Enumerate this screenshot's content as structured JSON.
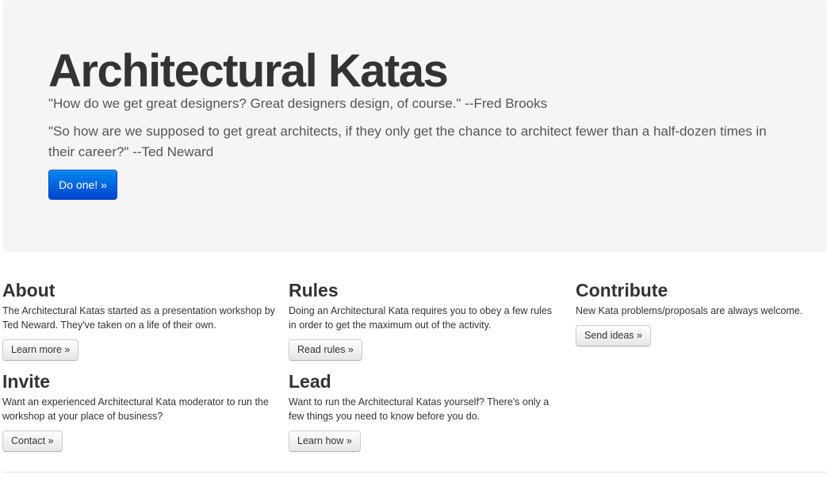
{
  "hero": {
    "title": "Architectural Katas",
    "quote1": "\"How do we get great designers? Great designers design, of course.\" --Fred Brooks",
    "quote2": "\"So how are we supposed to get great architects, if they only get the chance to architect fewer than a half-dozen times in their career?\" --Ted Neward",
    "cta_label": "Do one! »"
  },
  "sections": {
    "about": {
      "title": "About",
      "text": "The Architectural Katas started as a presentation workshop by Ted Neward. They've taken on a life of their own.",
      "button": "Learn more »"
    },
    "rules": {
      "title": "Rules",
      "text": "Doing an Architectural Kata requires you to obey a few rules in order to get the maximum out of the activity.",
      "button": "Read rules »"
    },
    "contribute": {
      "title": "Contribute",
      "text": "New Kata problems/proposals are always welcome.",
      "button": "Send ideas »"
    },
    "invite": {
      "title": "Invite",
      "text": "Want an experienced Architectural Kata moderator to run the workshop at your place of business?",
      "button": "Contact »"
    },
    "lead": {
      "title": "Lead",
      "text": "Want to run the Architectural Katas yourself? There's only a few things you need to know before you do.",
      "button": "Learn how »"
    }
  },
  "colors": {
    "hero_background": "#f5f5f5",
    "primary_button_top": "#0088ee",
    "primary_button_bottom": "#0044cc",
    "text": "#333333"
  }
}
